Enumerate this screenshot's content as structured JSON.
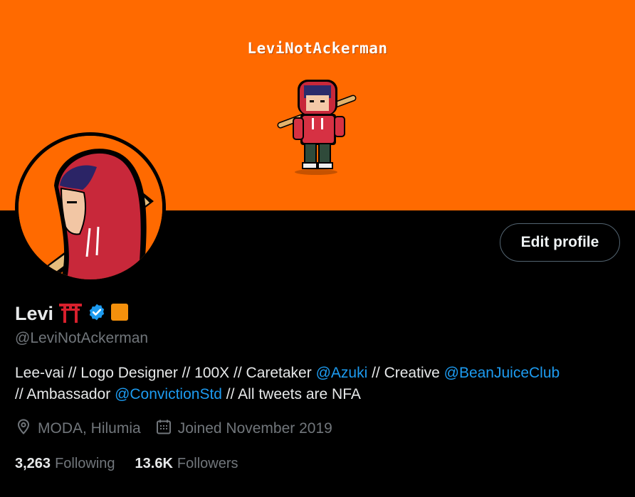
{
  "banner": {
    "title": "LeviNotAckerman",
    "background_color": "#ff6a00"
  },
  "profile": {
    "display_name": "Levi",
    "name_emojis": [
      "torii-gate-emoji",
      "verified-badge-icon",
      "orange-square-emoji"
    ],
    "handle": "@LeviNotAckerman",
    "edit_button_label": "Edit profile",
    "bio": {
      "text_1": "Lee-vai // Logo Designer // 100X // Caretaker ",
      "link_1": "@Azuki",
      "text_2": " // Creative ",
      "link_2": "@BeanJuiceClub",
      "text_3": " // Ambassador ",
      "link_3": "@ConvictionStd",
      "text_4": " // All tweets are NFA"
    },
    "location": "MODA, Hilumia",
    "joined": "Joined November 2019",
    "following_count": "3,263",
    "following_label": "Following",
    "followers_count": "13.6K",
    "followers_label": "Followers"
  },
  "colors": {
    "link": "#1d9bf0",
    "verified": "#1d9bf0",
    "muted": "#71767b"
  }
}
